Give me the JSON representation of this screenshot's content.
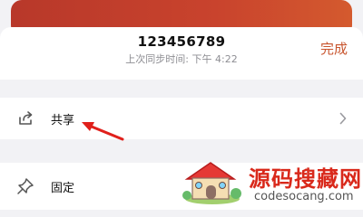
{
  "header": {
    "title": "123456789",
    "sync_status": "上次同步时间: 下午 4:22",
    "done_label": "完成"
  },
  "menu": {
    "items": [
      {
        "label": "共享",
        "icon": "share-icon",
        "has_chevron": true
      },
      {
        "label": "固定",
        "icon": "pin-icon",
        "has_chevron": false
      }
    ]
  },
  "watermark": {
    "title": "源码搜藏网",
    "url": "codesocang.com"
  },
  "colors": {
    "accent": "#c8552e",
    "arrow": "#e0201b",
    "card": "#c9432d"
  }
}
